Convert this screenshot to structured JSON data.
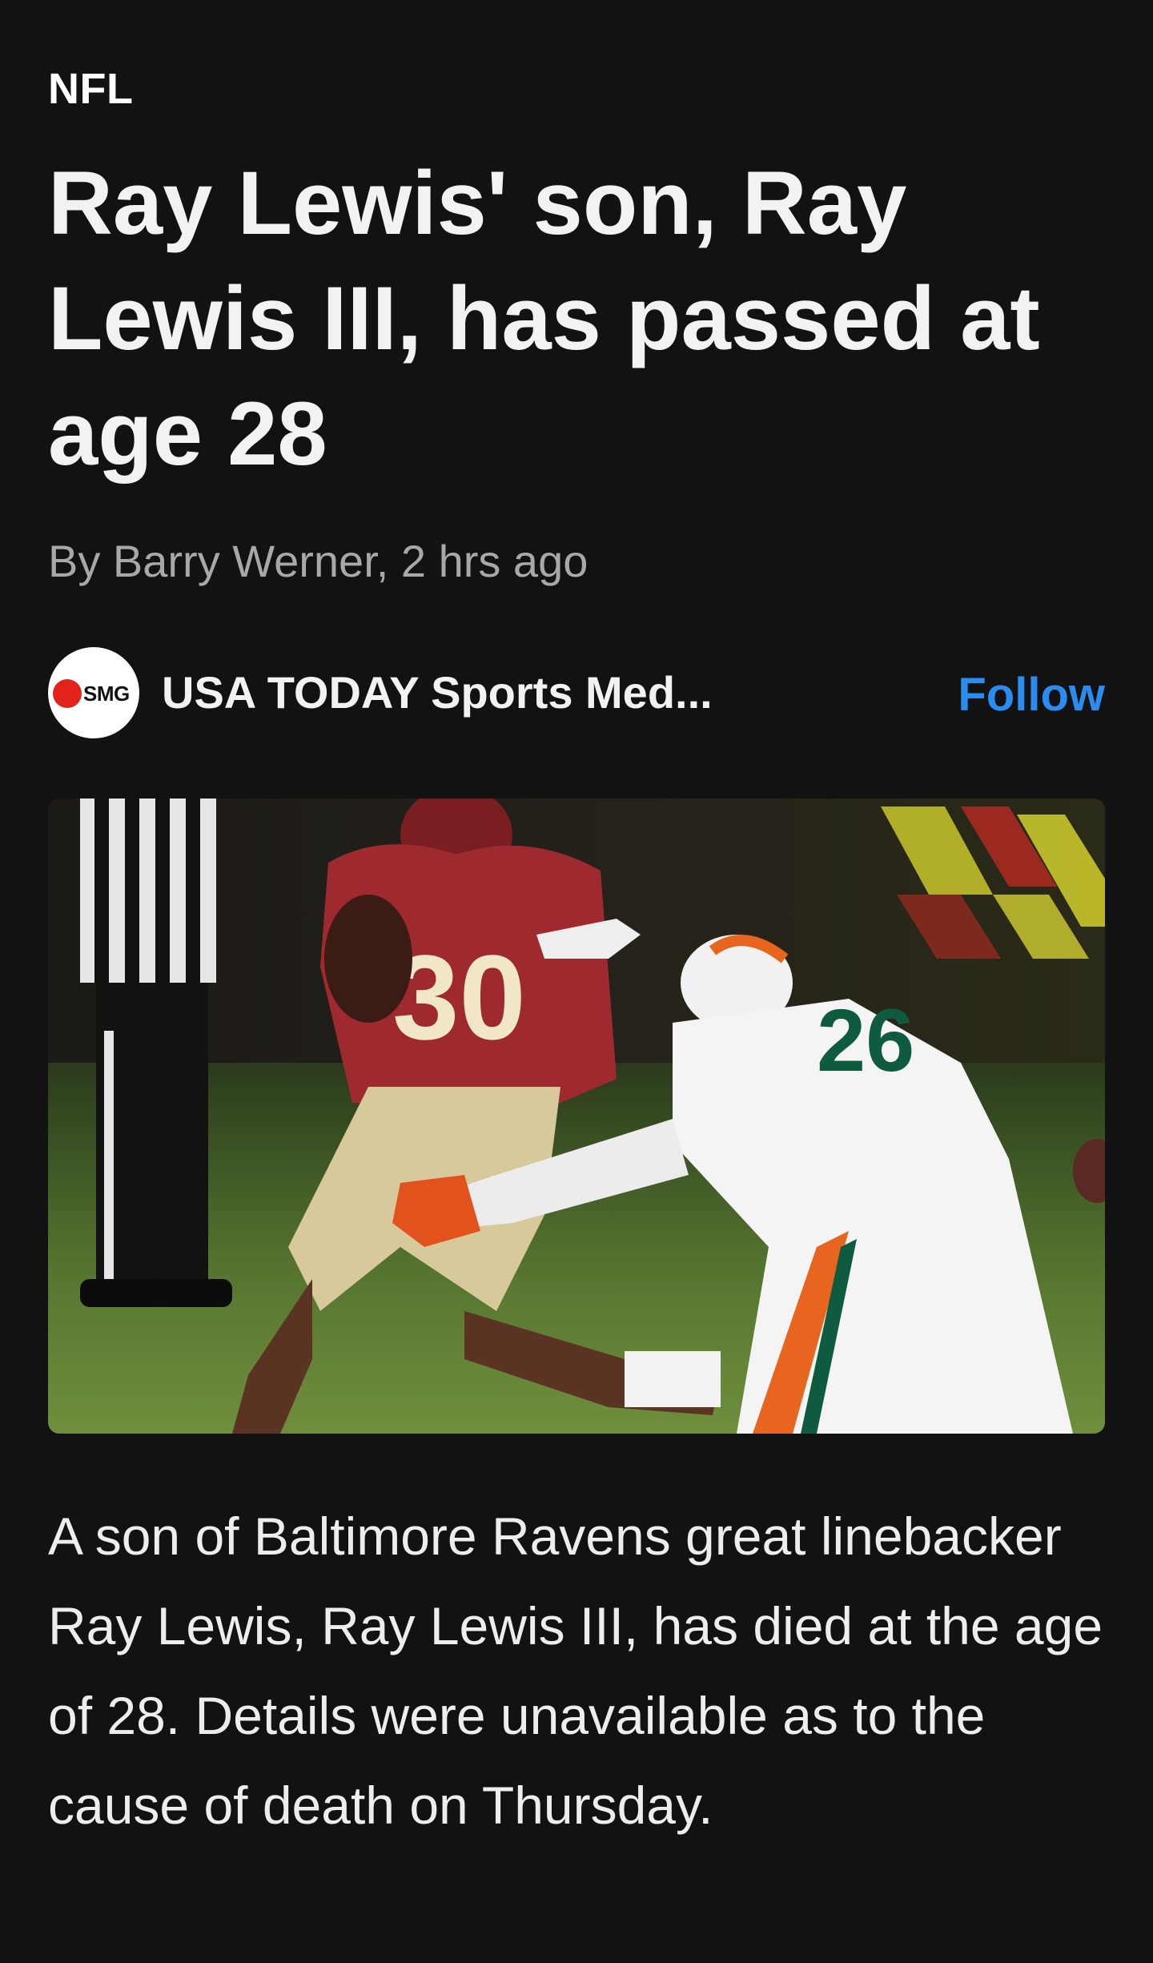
{
  "article": {
    "category": "NFL",
    "headline": "Ray Lewis' son, Ray Lewis III, has passed at age 28",
    "byline": "By Barry Werner, 2 hrs ago",
    "body": "A son of Baltimore Ravens great linebacker Ray Lewis, Ray Lewis III, has died at the age of 28. Details were unavailable as to the cause of death on Thursday."
  },
  "source": {
    "logo_text": "SMG",
    "name": "USA TODAY Sports Med...",
    "follow_label": "Follow"
  },
  "colors": {
    "background": "#121212",
    "accent": "#2b8cf0",
    "logo_dot": "#e2231a"
  },
  "icons": {
    "source_logo": "smg-logo"
  }
}
